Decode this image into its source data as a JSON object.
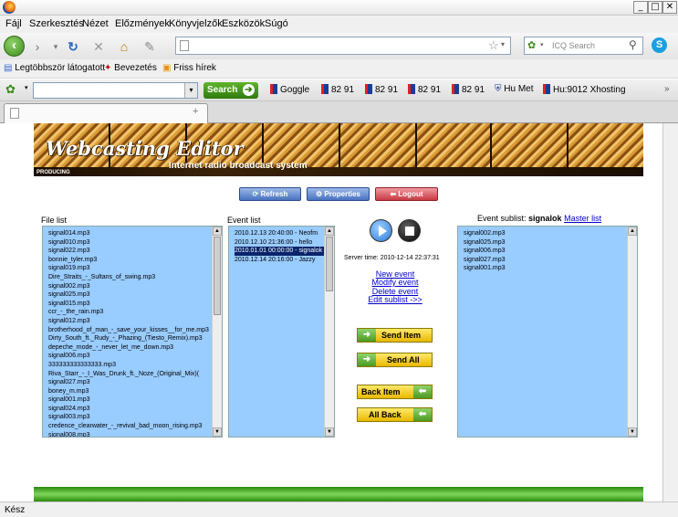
{
  "browser": {
    "menu": [
      "Fájl",
      "Szerkesztés",
      "Nézet",
      "Előzmények",
      "Könyvjelzők",
      "Eszközök",
      "Súgó"
    ],
    "window_buttons": {
      "min": "_",
      "max": "□",
      "close": "✕"
    },
    "search_placeholder": "ICQ Search",
    "bookmarks": [
      "Legtöbbször látogatott",
      "Bevezetés",
      "Friss hírek"
    ],
    "icq_search_label": "Search",
    "toolbar_items": [
      "Goggle",
      "82 91",
      "82 91",
      "82 91",
      "82 91",
      "Hu Met",
      "Hu:9012 Xhosting"
    ],
    "new_tab": "+",
    "status": "Kész"
  },
  "app": {
    "title": "Webcasting Editor",
    "subtitle": "Internet radio broadcast system",
    "producing": "PRODUCING",
    "buttons": {
      "refresh": "Refresh",
      "properties": "Properties",
      "logout": "Logout"
    },
    "file_list_label": "File list",
    "event_list_label": "Event list",
    "event_sublist_label": "Event sublist:",
    "event_sublist_name": "signalok",
    "master_list": "Master list",
    "server_time_label": "Server time:",
    "server_time": "2010-12-14 22:37:31",
    "links": [
      "New event",
      "Modify event",
      "Delete event",
      "Edit sublist ->>"
    ],
    "send_item": "Send Item",
    "send_all": "Send All",
    "back_item": "Back Item",
    "all_back": "All Back",
    "file_list": [
      "signal014.mp3",
      "signal010.mp3",
      "signal022.mp3",
      "bonnie_tyler.mp3",
      "signal019.mp3",
      "Dire_Straits_-_Sultans_of_swing.mp3",
      "signal002.mp3",
      "signal025.mp3",
      "signal015.mp3",
      "ccr_-_the_rain.mp3",
      "signal012.mp3",
      "brotherhood_of_man_-_save_your_kisses__for_me.mp3",
      "Dirty_South_ft._Rudy_-_Phazing_(Tiesto_Remix).mp3",
      "depeche_mode_-_never_let_me_down.mp3",
      "signal006.mp3",
      "333333333333333.mp3",
      "Riva_Starr_-_I_Was_Drunk_ft._Noze_(Original_Mix)(",
      "signal027.mp3",
      "boney_m.mp3",
      "signal001.mp3",
      "signal024.mp3",
      "signal003.mp3",
      "credence_clearwater_-_revival_bad_moon_rising.mp3",
      "signal008.mp3"
    ],
    "event_list": [
      "2010.12.13 20:40:00 - Neofm",
      "2010.12.10 21:36:00 - hello",
      "2010.01.01 00:00:00 - signalok",
      "2010.12.14 20:16:00 - Jazzy"
    ],
    "event_selected_index": 2,
    "sublist": [
      "signal002.mp3",
      "signal025.mp3",
      "signal006.mp3",
      "signal027.mp3",
      "signal001.mp3"
    ]
  }
}
